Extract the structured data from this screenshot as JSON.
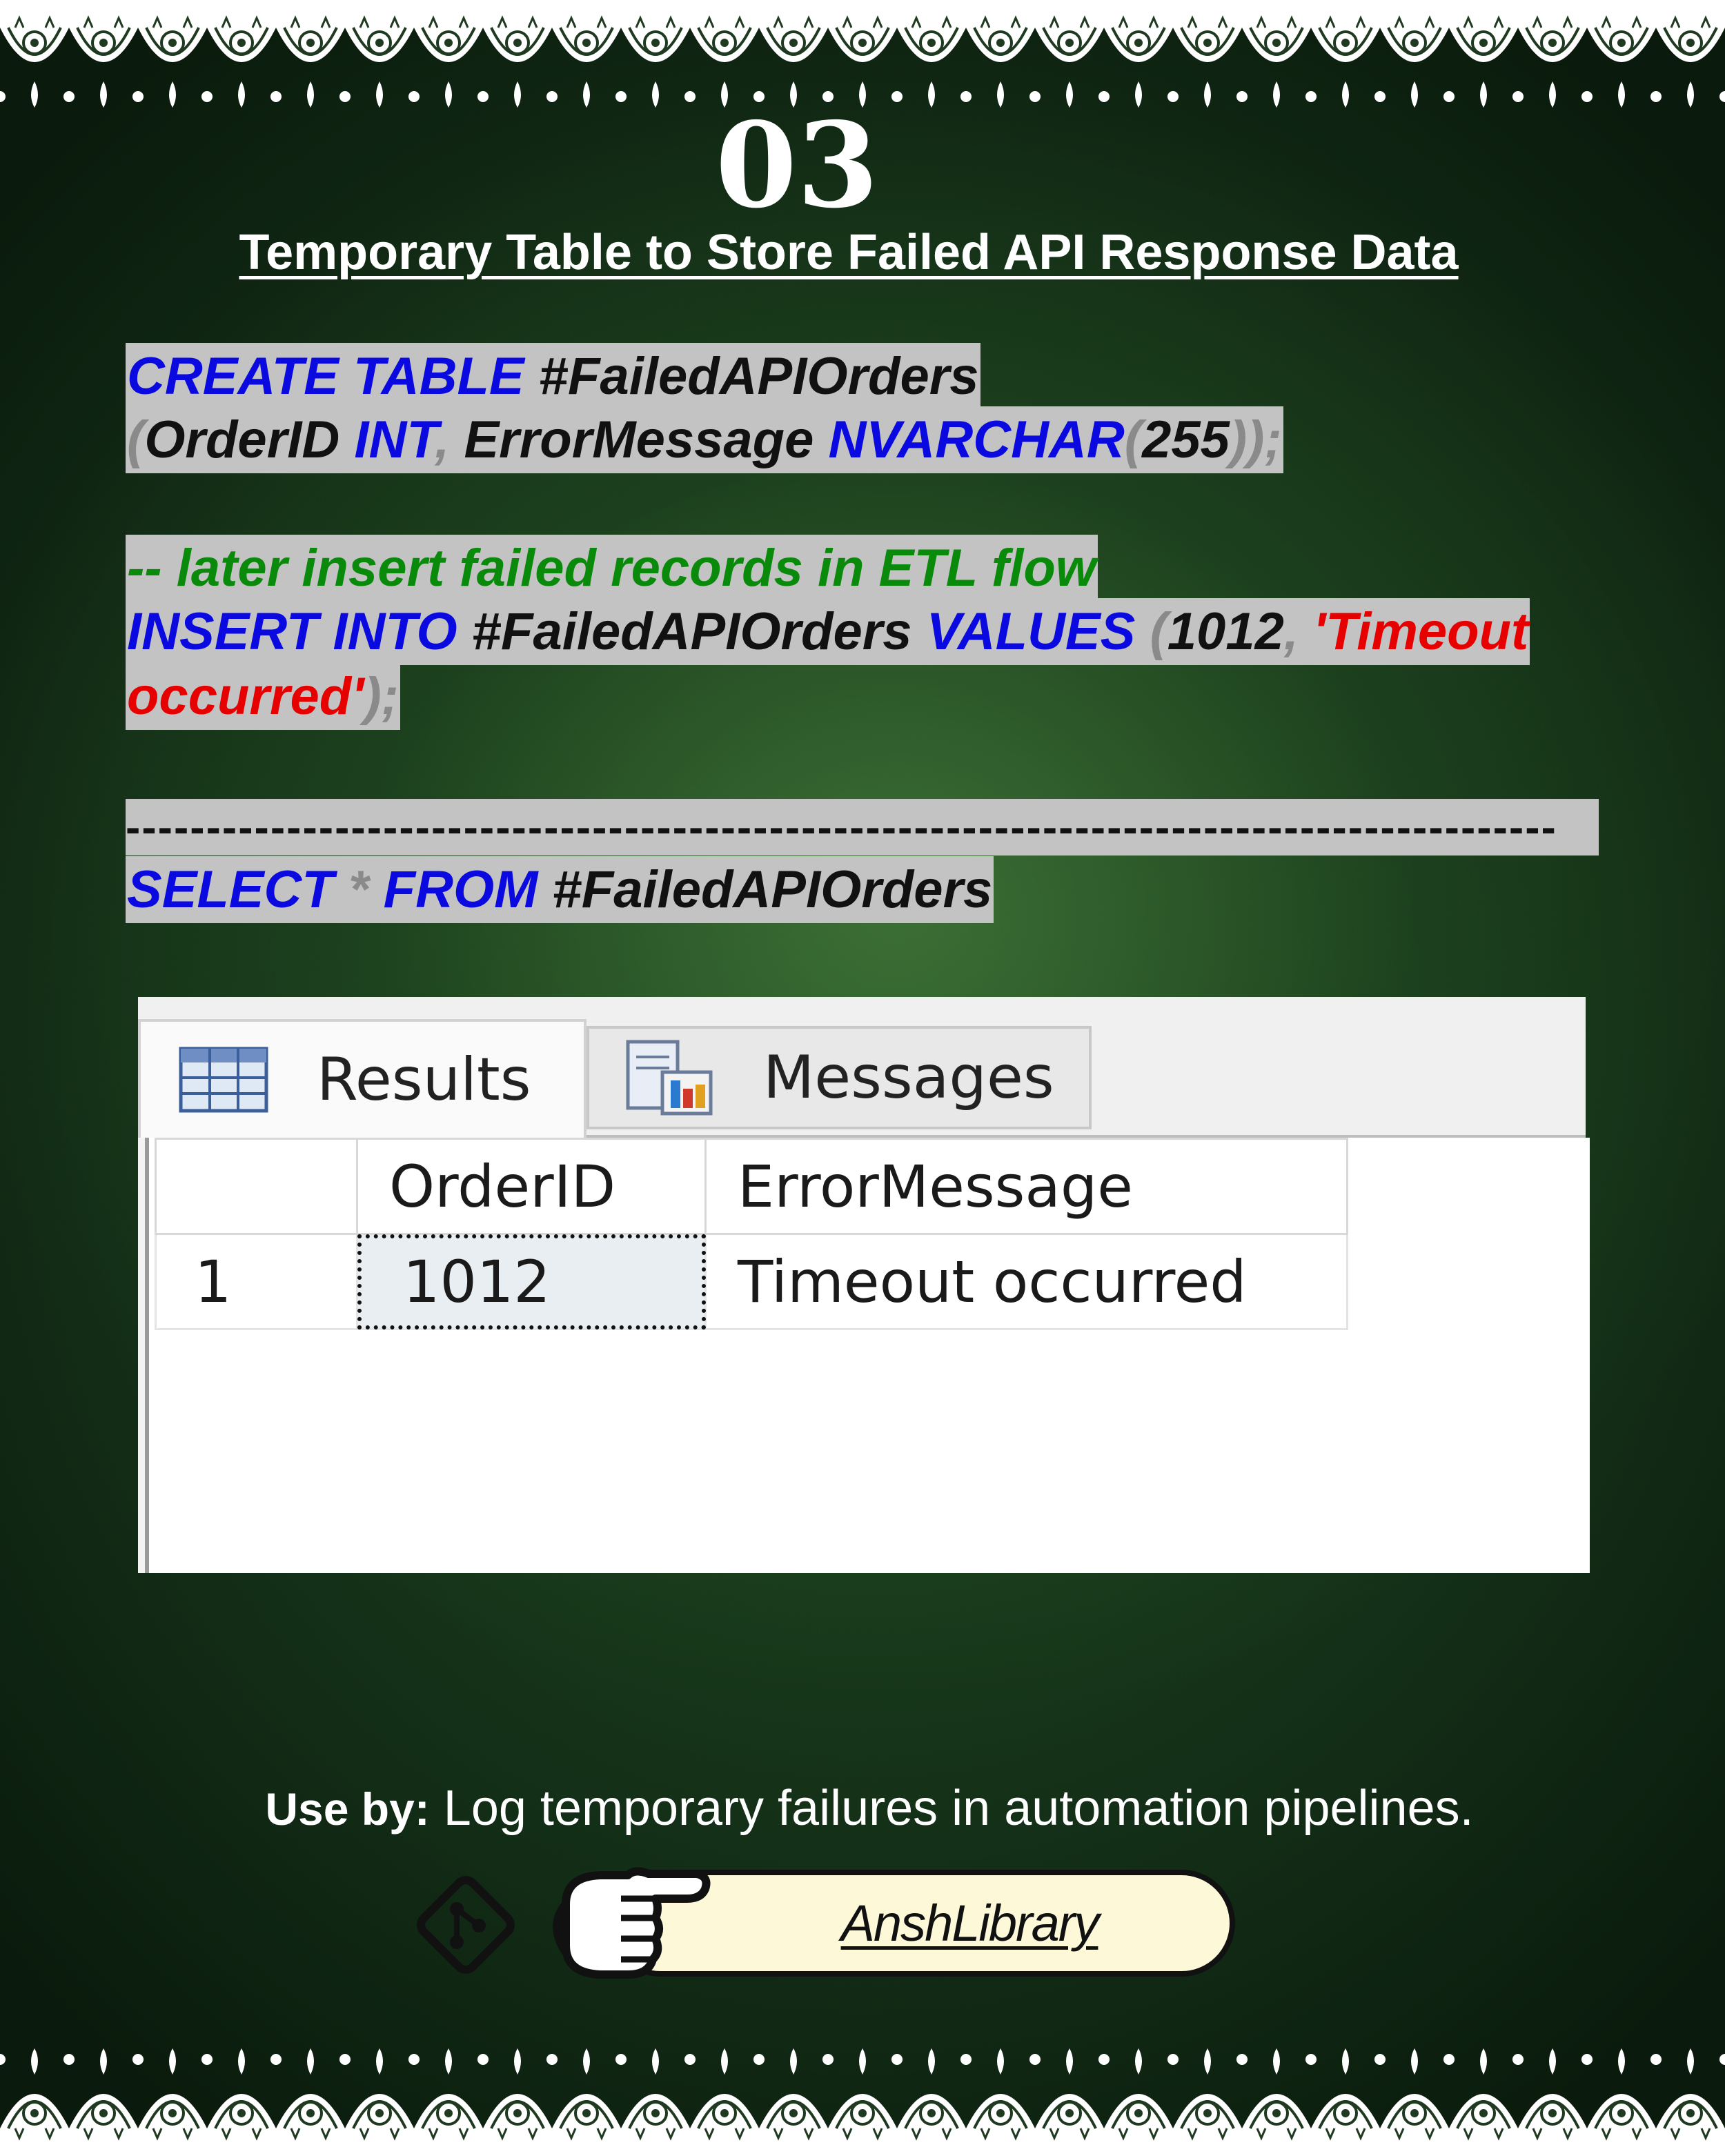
{
  "header": {
    "number": "03",
    "title": "Temporary Table to Store Failed API Response Data"
  },
  "code": {
    "line1": {
      "kw1": "CREATE",
      "kw2": "TABLE",
      "name": "#FailedAPIOrders"
    },
    "line2": {
      "open": "(",
      "col1": "OrderID",
      "type1": "INT",
      "comma": ",",
      "col2": "ErrorMessage",
      "type2": "NVARCHAR",
      "paren_open": "(",
      "size": "255",
      "close": "));"
    },
    "comment": "-- later insert failed records in ETL flow",
    "line4": {
      "kw1": "INSERT",
      "kw2": "INTO",
      "name": "#FailedAPIOrders",
      "kw3": "VALUES",
      "open": "(",
      "value": "1012",
      "comma": ",",
      "str1": "'Timeout"
    },
    "line5": {
      "str2": "occurred'",
      "close": ");"
    },
    "separator": "-----------------------------------------------------------------------------------------",
    "line7": {
      "kw1": "SELECT",
      "star": "*",
      "kw2": "FROM",
      "name": "#FailedAPIOrders"
    }
  },
  "results_panel": {
    "tabs": [
      {
        "label": "Results",
        "icon": "grid-icon",
        "active": true
      },
      {
        "label": "Messages",
        "icon": "messages-icon",
        "active": false
      }
    ],
    "columns": [
      "",
      "OrderID",
      "ErrorMessage"
    ],
    "rows": [
      {
        "row_number": "1",
        "OrderID": "1012",
        "ErrorMessage": "Timeout occurred"
      }
    ]
  },
  "footer": {
    "use_by_label": "Use by:",
    "use_by_text": "Log temporary failures in automation pipelines.",
    "brand": "AnshLibrary",
    "icons": [
      "git-icon",
      "pointing-hand-icon"
    ]
  },
  "colors": {
    "keyword": "#0a0ae0",
    "string": "#e60000",
    "comment": "#0a8a0a",
    "highlight": "#c3c3c3",
    "background": "#1f4a22"
  }
}
